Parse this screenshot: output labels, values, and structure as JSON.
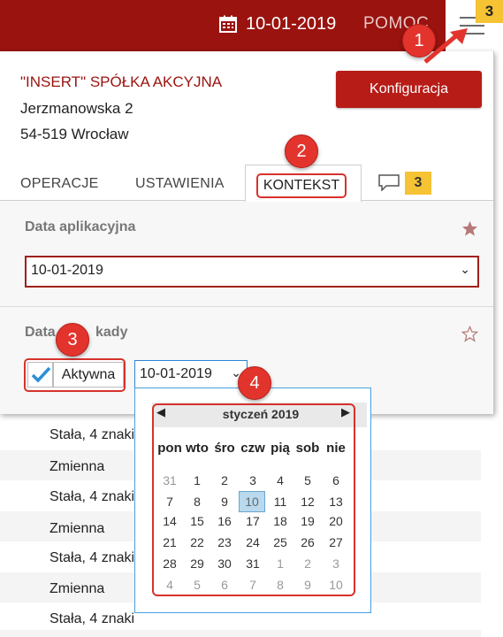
{
  "header": {
    "date": "10-01-2019",
    "help_label": "POMOC",
    "menu_badge": "3"
  },
  "company": {
    "name": "\"INSERT\" SPÓŁKA AKCYJNA",
    "street": "Jerzmanowska 2",
    "city": "54-519 Wrocław",
    "config_button": "Konfiguracja"
  },
  "tabs": {
    "operations": "OPERACJE",
    "settings": "USTAWIENIA",
    "context": "KONTEKST",
    "comments_count": "3"
  },
  "context": {
    "app_date_label": "Data aplikacyjna",
    "app_date_value": "10-01-2019",
    "doc_date_label": "Data dokumentu",
    "doc_date_label_visible": "Data",
    "doc_date_label_tail": "kady",
    "active_label": "Aktywna",
    "doc_date_value": "10-01-2019"
  },
  "calendar": {
    "month_title": "styczeń 2019",
    "weekdays": [
      "pon",
      "wto",
      "śro",
      "czw",
      "pią",
      "sob",
      "nie"
    ],
    "weeks": [
      [
        "31",
        "1",
        "2",
        "3",
        "4",
        "5",
        "6"
      ],
      [
        "7",
        "8",
        "9",
        "10",
        "11",
        "12",
        "13"
      ],
      [
        "14",
        "15",
        "16",
        "17",
        "18",
        "19",
        "20"
      ],
      [
        "21",
        "22",
        "23",
        "24",
        "25",
        "26",
        "27"
      ],
      [
        "28",
        "29",
        "30",
        "31",
        "1",
        "2",
        "3"
      ],
      [
        "4",
        "5",
        "6",
        "7",
        "8",
        "9",
        "10"
      ]
    ],
    "selected_day": "10"
  },
  "background_list": [
    "Stała, 4 znaki",
    "Zmienna",
    "Stała, 4 znaki",
    "Zmienna",
    "Stała, 4 znaki",
    "Zmienna",
    "Stała, 4 znaki"
  ],
  "callouts": [
    "1",
    "2",
    "3",
    "4"
  ]
}
